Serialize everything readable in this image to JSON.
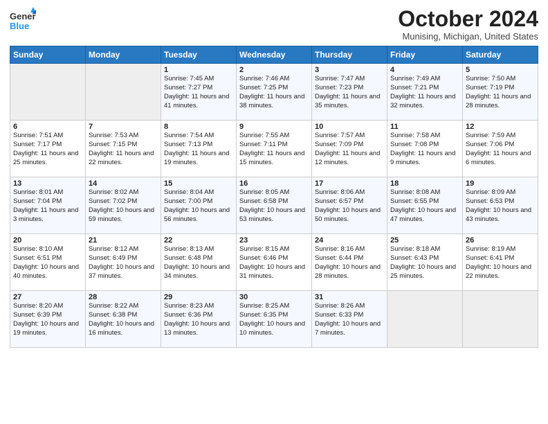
{
  "header": {
    "logo_general": "General",
    "logo_blue": "Blue",
    "month_title": "October 2024",
    "location": "Munising, Michigan, United States"
  },
  "days_of_week": [
    "Sunday",
    "Monday",
    "Tuesday",
    "Wednesday",
    "Thursday",
    "Friday",
    "Saturday"
  ],
  "weeks": [
    [
      {
        "num": "",
        "sunrise": "",
        "sunset": "",
        "daylight": ""
      },
      {
        "num": "",
        "sunrise": "",
        "sunset": "",
        "daylight": ""
      },
      {
        "num": "1",
        "sunrise": "Sunrise: 7:45 AM",
        "sunset": "Sunset: 7:27 PM",
        "daylight": "Daylight: 11 hours and 41 minutes."
      },
      {
        "num": "2",
        "sunrise": "Sunrise: 7:46 AM",
        "sunset": "Sunset: 7:25 PM",
        "daylight": "Daylight: 11 hours and 38 minutes."
      },
      {
        "num": "3",
        "sunrise": "Sunrise: 7:47 AM",
        "sunset": "Sunset: 7:23 PM",
        "daylight": "Daylight: 11 hours and 35 minutes."
      },
      {
        "num": "4",
        "sunrise": "Sunrise: 7:49 AM",
        "sunset": "Sunset: 7:21 PM",
        "daylight": "Daylight: 11 hours and 32 minutes."
      },
      {
        "num": "5",
        "sunrise": "Sunrise: 7:50 AM",
        "sunset": "Sunset: 7:19 PM",
        "daylight": "Daylight: 11 hours and 28 minutes."
      }
    ],
    [
      {
        "num": "6",
        "sunrise": "Sunrise: 7:51 AM",
        "sunset": "Sunset: 7:17 PM",
        "daylight": "Daylight: 11 hours and 25 minutes."
      },
      {
        "num": "7",
        "sunrise": "Sunrise: 7:53 AM",
        "sunset": "Sunset: 7:15 PM",
        "daylight": "Daylight: 11 hours and 22 minutes."
      },
      {
        "num": "8",
        "sunrise": "Sunrise: 7:54 AM",
        "sunset": "Sunset: 7:13 PM",
        "daylight": "Daylight: 11 hours and 19 minutes."
      },
      {
        "num": "9",
        "sunrise": "Sunrise: 7:55 AM",
        "sunset": "Sunset: 7:11 PM",
        "daylight": "Daylight: 11 hours and 15 minutes."
      },
      {
        "num": "10",
        "sunrise": "Sunrise: 7:57 AM",
        "sunset": "Sunset: 7:09 PM",
        "daylight": "Daylight: 11 hours and 12 minutes."
      },
      {
        "num": "11",
        "sunrise": "Sunrise: 7:58 AM",
        "sunset": "Sunset: 7:08 PM",
        "daylight": "Daylight: 11 hours and 9 minutes."
      },
      {
        "num": "12",
        "sunrise": "Sunrise: 7:59 AM",
        "sunset": "Sunset: 7:06 PM",
        "daylight": "Daylight: 11 hours and 6 minutes."
      }
    ],
    [
      {
        "num": "13",
        "sunrise": "Sunrise: 8:01 AM",
        "sunset": "Sunset: 7:04 PM",
        "daylight": "Daylight: 11 hours and 3 minutes."
      },
      {
        "num": "14",
        "sunrise": "Sunrise: 8:02 AM",
        "sunset": "Sunset: 7:02 PM",
        "daylight": "Daylight: 10 hours and 59 minutes."
      },
      {
        "num": "15",
        "sunrise": "Sunrise: 8:04 AM",
        "sunset": "Sunset: 7:00 PM",
        "daylight": "Daylight: 10 hours and 56 minutes."
      },
      {
        "num": "16",
        "sunrise": "Sunrise: 8:05 AM",
        "sunset": "Sunset: 6:58 PM",
        "daylight": "Daylight: 10 hours and 53 minutes."
      },
      {
        "num": "17",
        "sunrise": "Sunrise: 8:06 AM",
        "sunset": "Sunset: 6:57 PM",
        "daylight": "Daylight: 10 hours and 50 minutes."
      },
      {
        "num": "18",
        "sunrise": "Sunrise: 8:08 AM",
        "sunset": "Sunset: 6:55 PM",
        "daylight": "Daylight: 10 hours and 47 minutes."
      },
      {
        "num": "19",
        "sunrise": "Sunrise: 8:09 AM",
        "sunset": "Sunset: 6:53 PM",
        "daylight": "Daylight: 10 hours and 43 minutes."
      }
    ],
    [
      {
        "num": "20",
        "sunrise": "Sunrise: 8:10 AM",
        "sunset": "Sunset: 6:51 PM",
        "daylight": "Daylight: 10 hours and 40 minutes."
      },
      {
        "num": "21",
        "sunrise": "Sunrise: 8:12 AM",
        "sunset": "Sunset: 6:49 PM",
        "daylight": "Daylight: 10 hours and 37 minutes."
      },
      {
        "num": "22",
        "sunrise": "Sunrise: 8:13 AM",
        "sunset": "Sunset: 6:48 PM",
        "daylight": "Daylight: 10 hours and 34 minutes."
      },
      {
        "num": "23",
        "sunrise": "Sunrise: 8:15 AM",
        "sunset": "Sunset: 6:46 PM",
        "daylight": "Daylight: 10 hours and 31 minutes."
      },
      {
        "num": "24",
        "sunrise": "Sunrise: 8:16 AM",
        "sunset": "Sunset: 6:44 PM",
        "daylight": "Daylight: 10 hours and 28 minutes."
      },
      {
        "num": "25",
        "sunrise": "Sunrise: 8:18 AM",
        "sunset": "Sunset: 6:43 PM",
        "daylight": "Daylight: 10 hours and 25 minutes."
      },
      {
        "num": "26",
        "sunrise": "Sunrise: 8:19 AM",
        "sunset": "Sunset: 6:41 PM",
        "daylight": "Daylight: 10 hours and 22 minutes."
      }
    ],
    [
      {
        "num": "27",
        "sunrise": "Sunrise: 8:20 AM",
        "sunset": "Sunset: 6:39 PM",
        "daylight": "Daylight: 10 hours and 19 minutes."
      },
      {
        "num": "28",
        "sunrise": "Sunrise: 8:22 AM",
        "sunset": "Sunset: 6:38 PM",
        "daylight": "Daylight: 10 hours and 16 minutes."
      },
      {
        "num": "29",
        "sunrise": "Sunrise: 8:23 AM",
        "sunset": "Sunset: 6:36 PM",
        "daylight": "Daylight: 10 hours and 13 minutes."
      },
      {
        "num": "30",
        "sunrise": "Sunrise: 8:25 AM",
        "sunset": "Sunset: 6:35 PM",
        "daylight": "Daylight: 10 hours and 10 minutes."
      },
      {
        "num": "31",
        "sunrise": "Sunrise: 8:26 AM",
        "sunset": "Sunset: 6:33 PM",
        "daylight": "Daylight: 10 hours and 7 minutes."
      },
      {
        "num": "",
        "sunrise": "",
        "sunset": "",
        "daylight": ""
      },
      {
        "num": "",
        "sunrise": "",
        "sunset": "",
        "daylight": ""
      }
    ]
  ]
}
